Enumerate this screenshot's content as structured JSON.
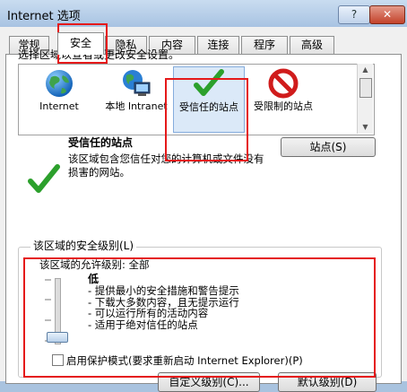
{
  "window": {
    "title": "Internet 选项",
    "help_label": "?",
    "close_label": "✕"
  },
  "tabs": [
    {
      "label": "常规"
    },
    {
      "label": "安全"
    },
    {
      "label": "隐私"
    },
    {
      "label": "内容"
    },
    {
      "label": "连接"
    },
    {
      "label": "程序"
    },
    {
      "label": "高级"
    }
  ],
  "security": {
    "select_zone_label": "选择区域以查看或更改安全设置。",
    "zones": [
      {
        "label": "Internet",
        "icon": "globe-icon"
      },
      {
        "label": "本地 Intranet",
        "icon": "intranet-icon"
      },
      {
        "label": "受信任的站点",
        "icon": "check-icon"
      },
      {
        "label": "受限制的站点",
        "icon": "no-entry-icon"
      }
    ],
    "sites_button": "站点(S)",
    "trusted_title": "受信任的站点",
    "trusted_desc": "该区域包含您信任对您的计算机或文件没有损害的网站。",
    "level_group_label": "该区域的安全级别(L)",
    "allowed_level": "该区域的允许级别: 全部",
    "level_name": "低",
    "level_items": [
      "- 提供最小的安全措施和警告提示",
      "- 下载大多数内容，且无提示运行",
      "- 可以运行所有的活动内容",
      "- 适用于绝对信任的站点"
    ],
    "slider_level": 0,
    "protected_mode_label": "启用保护模式(要求重新启动 Internet Explorer)(P)",
    "custom_level_button": "自定义级别(C)...",
    "default_level_button": "默认级别(D)"
  },
  "colors": {
    "highlight_red": "#e5191a",
    "selected_zone": "#dbe9f8"
  }
}
